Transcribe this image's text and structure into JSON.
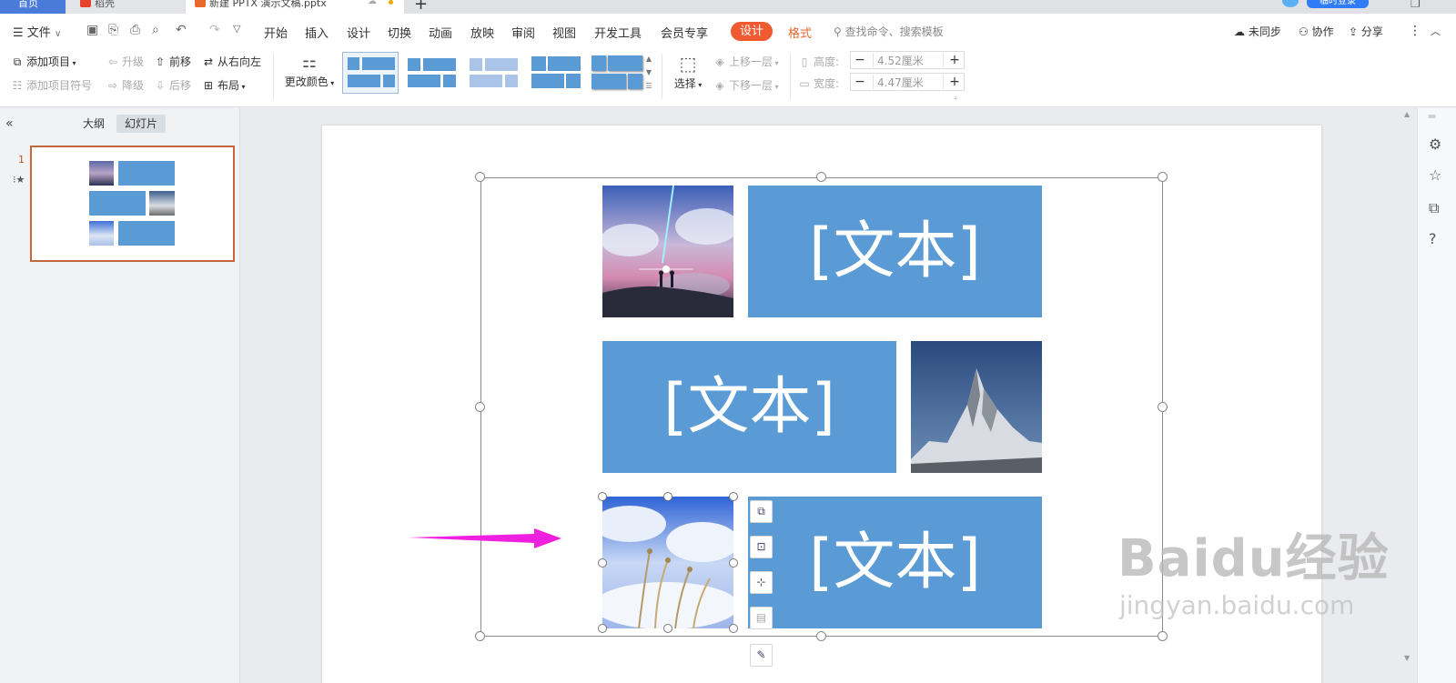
{
  "tabs": {
    "home": "首页",
    "doc1": "稻壳",
    "doc2": "新建 PPTX 演示文稿.pptx",
    "new_tab": "+",
    "login": "临时登录"
  },
  "menu": {
    "file": "文件",
    "items": [
      "开始",
      "插入",
      "设计",
      "切换",
      "动画",
      "放映",
      "审阅",
      "视图",
      "开发工具",
      "会员专享"
    ],
    "design_context": "设计",
    "format_context": "格式",
    "search_placeholder": "查找命令、搜索模板",
    "unsynced": "未同步",
    "collaborate": "协作",
    "share": "分享"
  },
  "tools": {
    "add_item": "添加项目",
    "add_bullet": "添加项目符号",
    "promote": "升级",
    "demote": "降级",
    "move_forward": "前移",
    "move_back": "后移",
    "right_to_left": "从右向左",
    "layout": "布局",
    "change_color": "更改颜色",
    "select": "选择",
    "bring_forward": "上移一层",
    "send_backward": "下移一层",
    "height_label": "高度:",
    "height_value": "4.52厘米",
    "width_label": "宽度:",
    "width_value": "4.47厘米"
  },
  "panel": {
    "tab_outline": "大纲",
    "tab_slides": "幻灯片",
    "slide_number": "1"
  },
  "slide": {
    "text1": "[文本]",
    "text2": "[文本]",
    "text3": "[文本]"
  },
  "watermark": {
    "brand": "Baidu经验",
    "url": "jingyan.baidu.com"
  },
  "colors": {
    "accent_orange": "#f05a30",
    "shape_blue": "#5b9bd5",
    "arrow_magenta": "#f020e0"
  }
}
